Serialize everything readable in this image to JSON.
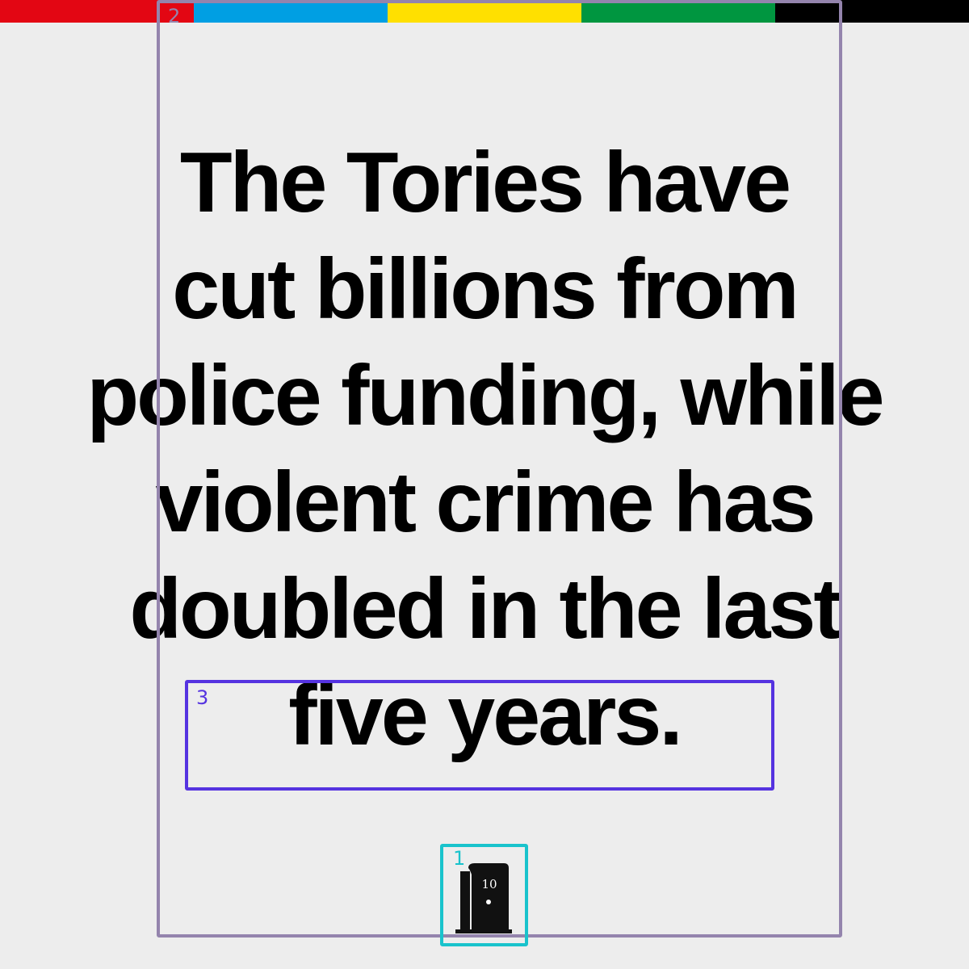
{
  "color_bar": {
    "colors": [
      "#e30613",
      "#009fe3",
      "#ffe000",
      "#009640",
      "#000000"
    ]
  },
  "annotations": [
    {
      "label": "2",
      "color": "#9484ad"
    },
    {
      "label": "3",
      "color": "#5533e0"
    },
    {
      "label": "1",
      "color": "#19c3cc"
    }
  ],
  "headline": {
    "lines": [
      "The Tories have",
      "cut billions from",
      "police funding, while",
      "violent crime has",
      "doubled in the last",
      "five years."
    ]
  },
  "logo": {
    "icon": "number-10-door-icon",
    "text": "10"
  }
}
